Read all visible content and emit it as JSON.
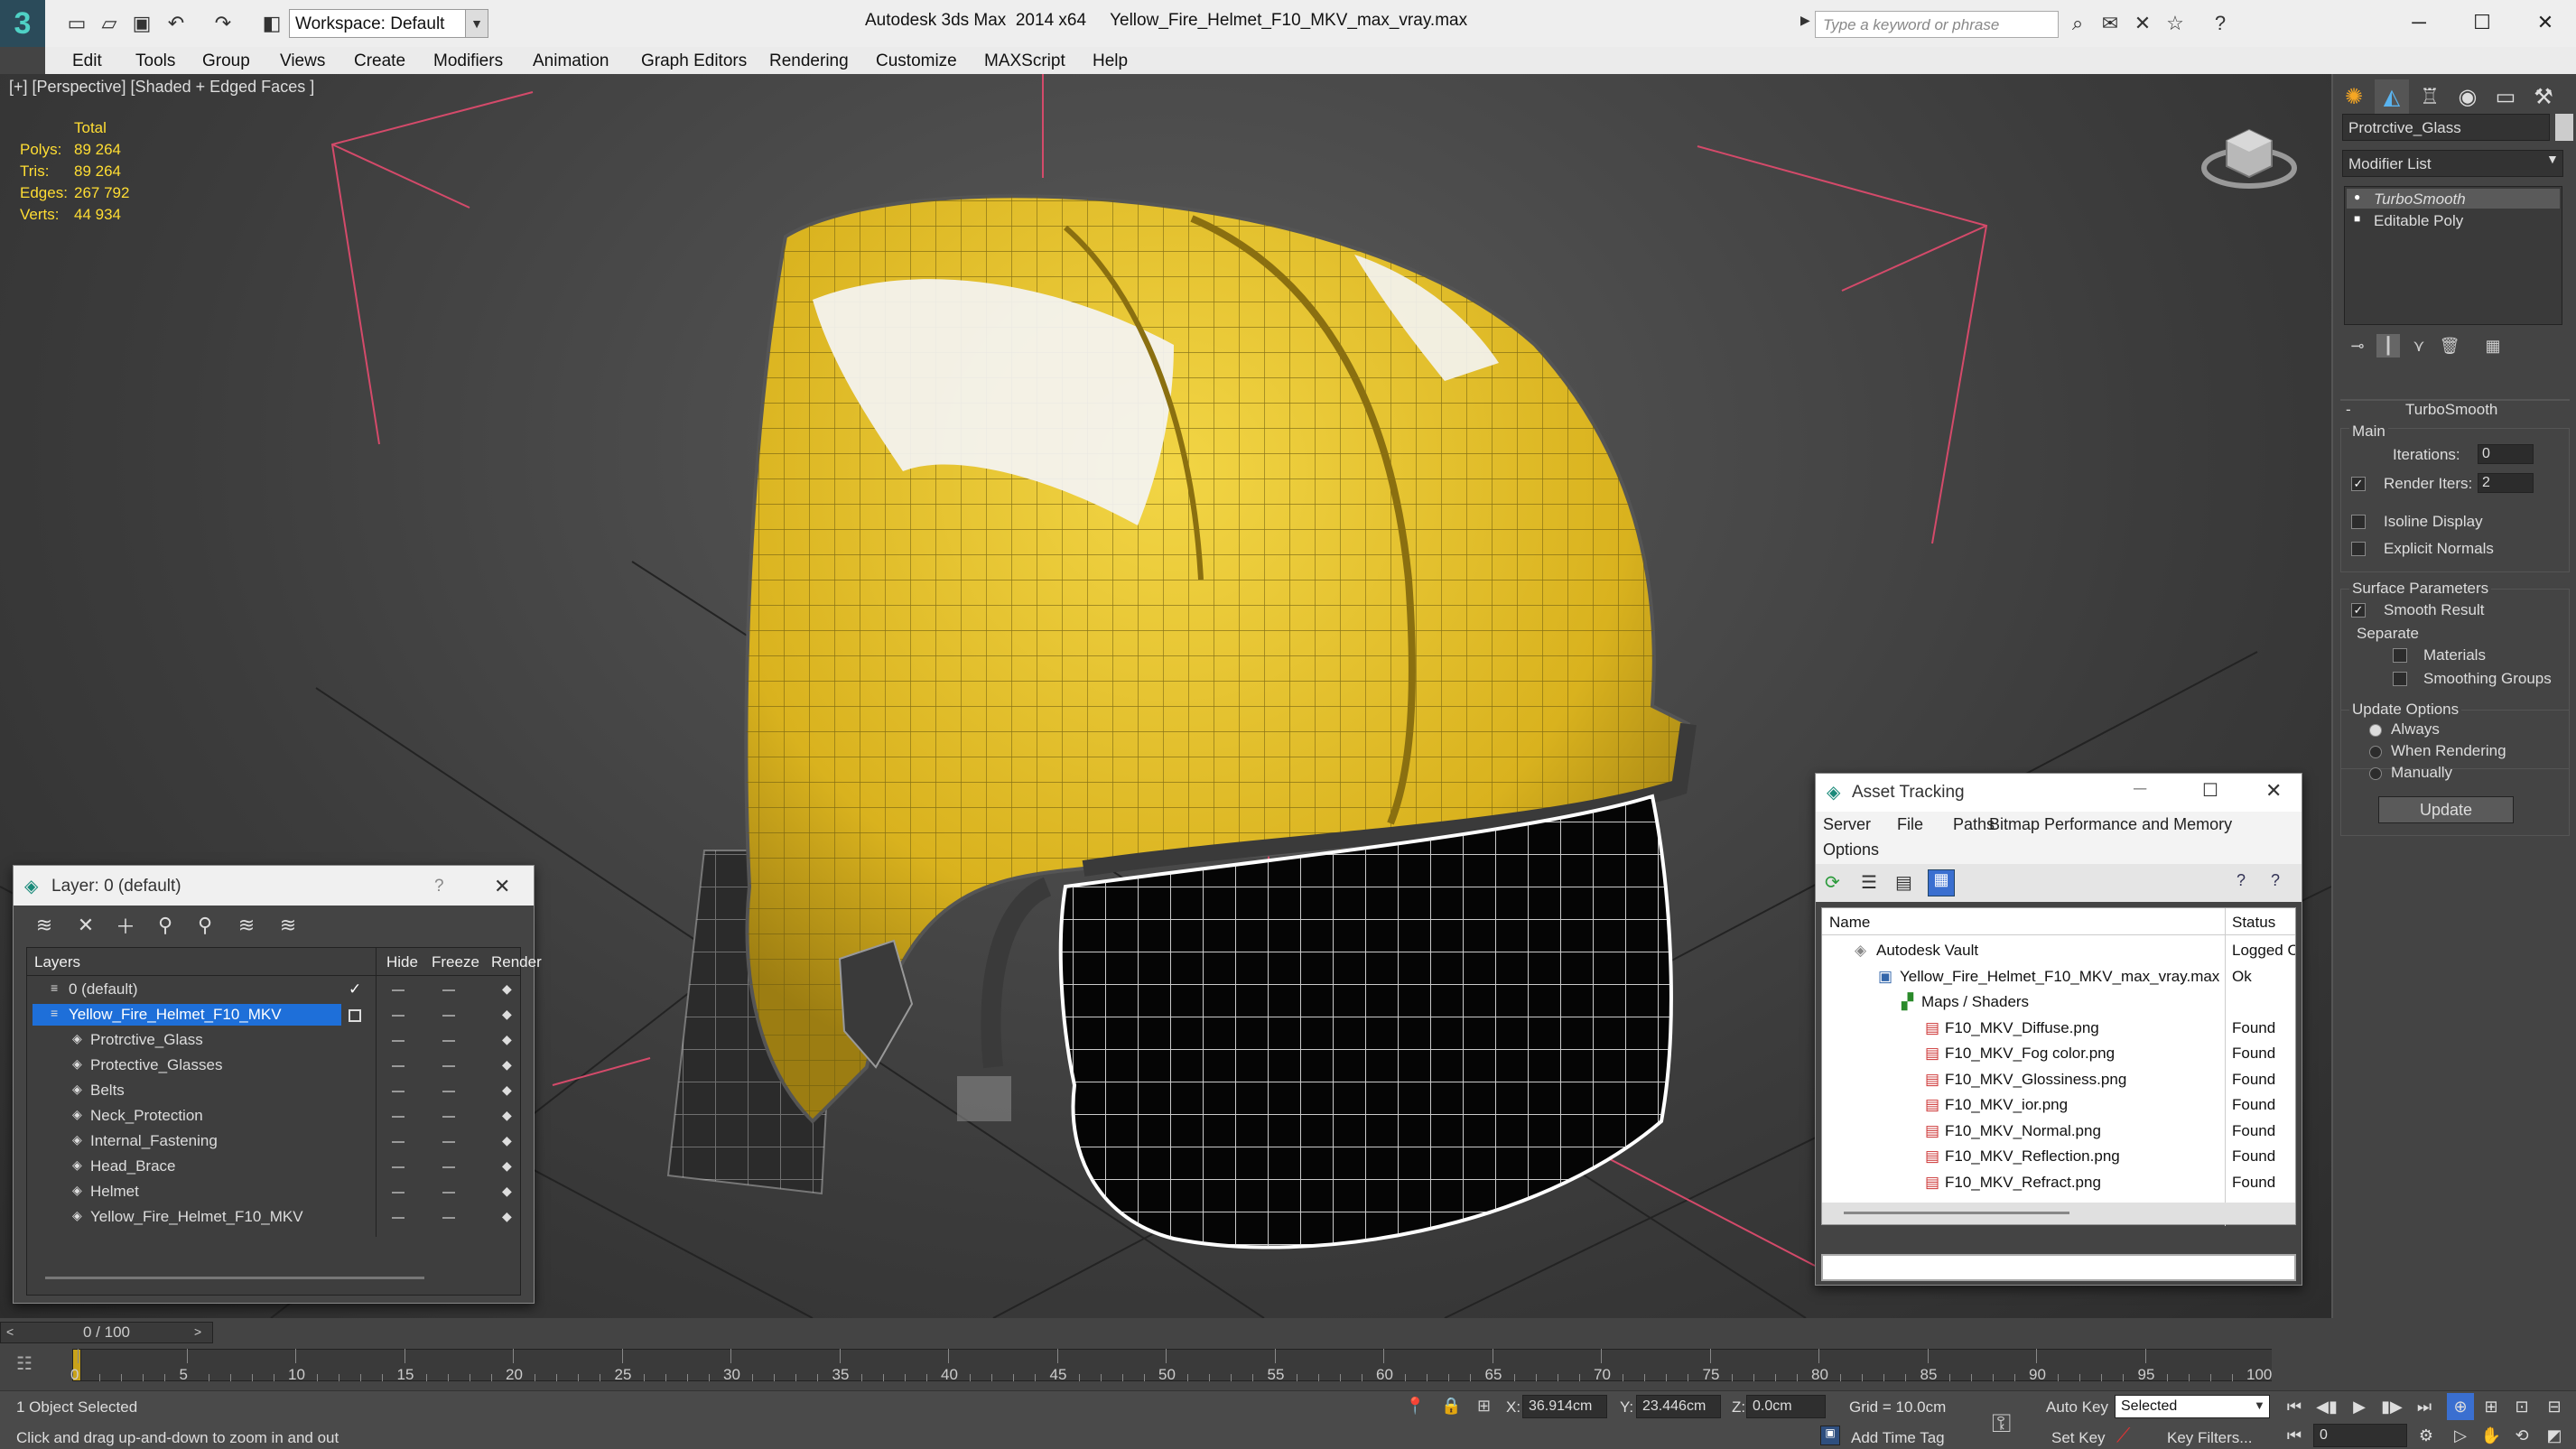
{
  "app": {
    "title": "Autodesk 3ds Max  2014 x64     Yellow_Fire_Helmet_F10_MKV_max_vray.max",
    "workspace": "Workspace: Default",
    "search_placeholder": "Type a keyword or phrase"
  },
  "menu": [
    "Edit",
    "Tools",
    "Group",
    "Views",
    "Create",
    "Modifiers",
    "Animation",
    "Graph Editors",
    "Rendering",
    "Customize",
    "MAXScript",
    "Help"
  ],
  "viewport": {
    "label": "[+] [Perspective] [Shaded + Edged Faces ]",
    "stats_header": "Total",
    "stats": [
      {
        "label": "Polys:",
        "value": "89 264"
      },
      {
        "label": "Tris:",
        "value": "89 264"
      },
      {
        "label": "Edges:",
        "value": "267 792"
      },
      {
        "label": "Verts:",
        "value": "44 934"
      }
    ]
  },
  "command_panel": {
    "object_name": "Protrctive_Glass",
    "modifier_list": "Modifier List",
    "stack": [
      "TurboSmooth",
      "Editable Poly"
    ],
    "rollout_title": "TurboSmooth",
    "main_label": "Main",
    "iterations_label": "Iterations:",
    "iterations_value": "0",
    "render_iters_label": "Render Iters:",
    "render_iters_value": "2",
    "isoline": "Isoline Display",
    "explicit_normals": "Explicit Normals",
    "surface_params": "Surface Parameters",
    "smooth_result": "Smooth Result",
    "separate": "Separate",
    "materials": "Materials",
    "smoothing_groups": "Smoothing Groups",
    "update_options": "Update Options",
    "always": "Always",
    "when_rendering": "When Rendering",
    "manually": "Manually",
    "update_button": "Update"
  },
  "layer_window": {
    "title": "Layer: 0 (default)",
    "help": "?",
    "columns": [
      "Layers",
      "Hide",
      "Freeze",
      "Render"
    ],
    "rows": [
      {
        "name": "0 (default)"
      },
      {
        "name": "Yellow_Fire_Helmet_F10_MKV"
      },
      {
        "name": "Protrctive_Glass"
      },
      {
        "name": "Protective_Glasses"
      },
      {
        "name": "Belts"
      },
      {
        "name": "Neck_Protection"
      },
      {
        "name": "Internal_Fastening"
      },
      {
        "name": "Head_Brace"
      },
      {
        "name": "Helmet"
      },
      {
        "name": "Yellow_Fire_Helmet_F10_MKV"
      }
    ]
  },
  "asset_window": {
    "title": "Asset Tracking",
    "menu": [
      "Server",
      "File",
      "Paths",
      "Bitmap Performance and Memory",
      "Options"
    ],
    "columns": [
      "Name",
      "Status"
    ],
    "rows": [
      {
        "name": "Autodesk Vault",
        "status": "Logged O"
      },
      {
        "name": "Yellow_Fire_Helmet_F10_MKV_max_vray.max",
        "status": "Ok"
      },
      {
        "name": "Maps / Shaders",
        "status": ""
      },
      {
        "name": "F10_MKV_Diffuse.png",
        "status": "Found"
      },
      {
        "name": "F10_MKV_Fog color.png",
        "status": "Found"
      },
      {
        "name": "F10_MKV_Glossiness.png",
        "status": "Found"
      },
      {
        "name": "F10_MKV_ior.png",
        "status": "Found"
      },
      {
        "name": "F10_MKV_Normal.png",
        "status": "Found"
      },
      {
        "name": "F10_MKV_Reflection.png",
        "status": "Found"
      },
      {
        "name": "F10_MKV_Refract.png",
        "status": "Found"
      }
    ]
  },
  "timeline": {
    "frame": "0 / 100",
    "ticks": [
      "0",
      "5",
      "10",
      "15",
      "20",
      "25",
      "30",
      "35",
      "40",
      "45",
      "50",
      "55",
      "60",
      "65",
      "70",
      "75",
      "80",
      "85",
      "90",
      "95",
      "100"
    ]
  },
  "status": {
    "selection": "1 Object Selected",
    "hint": "Click and drag up-and-down to zoom in and out",
    "x_label": "X:",
    "x_value": "36.914cm",
    "y_label": "Y:",
    "y_value": "23.446cm",
    "z_label": "Z:",
    "z_value": "0.0cm",
    "grid": "Grid = 10.0cm",
    "auto_key": "Auto Key",
    "selected": "Selected",
    "set_key": "Set Key",
    "key_filters": "Key Filters...",
    "add_time_tag": "Add Time Tag",
    "frame_value": "0"
  },
  "colors": {
    "helmet_yellow": "#e8c62a",
    "stats_yellow": "#ffdd33",
    "selection_blue": "#1e6fd9"
  }
}
